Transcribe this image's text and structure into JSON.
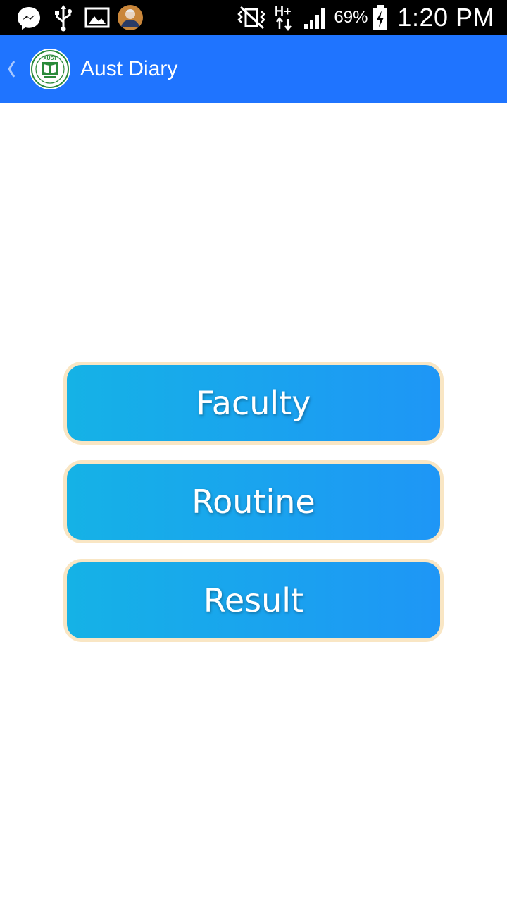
{
  "status_bar": {
    "battery_percent": "69%",
    "time": "1:20 PM",
    "icons": [
      "messenger-icon",
      "usb-icon",
      "gallery-icon",
      "contact-avatar",
      "vibrate-icon",
      "network-hplus-icon",
      "signal-icon",
      "battery-charging-icon"
    ]
  },
  "action_bar": {
    "title": "Aust Diary",
    "logo_text": "AUST",
    "background_color": "#1f74ff"
  },
  "menu": {
    "buttons": [
      {
        "label": "Faculty"
      },
      {
        "label": "Routine"
      },
      {
        "label": "Result"
      }
    ],
    "gradient_start": "#15b2e6",
    "gradient_end": "#1e96f6",
    "border_color": "#f9e6c4"
  }
}
